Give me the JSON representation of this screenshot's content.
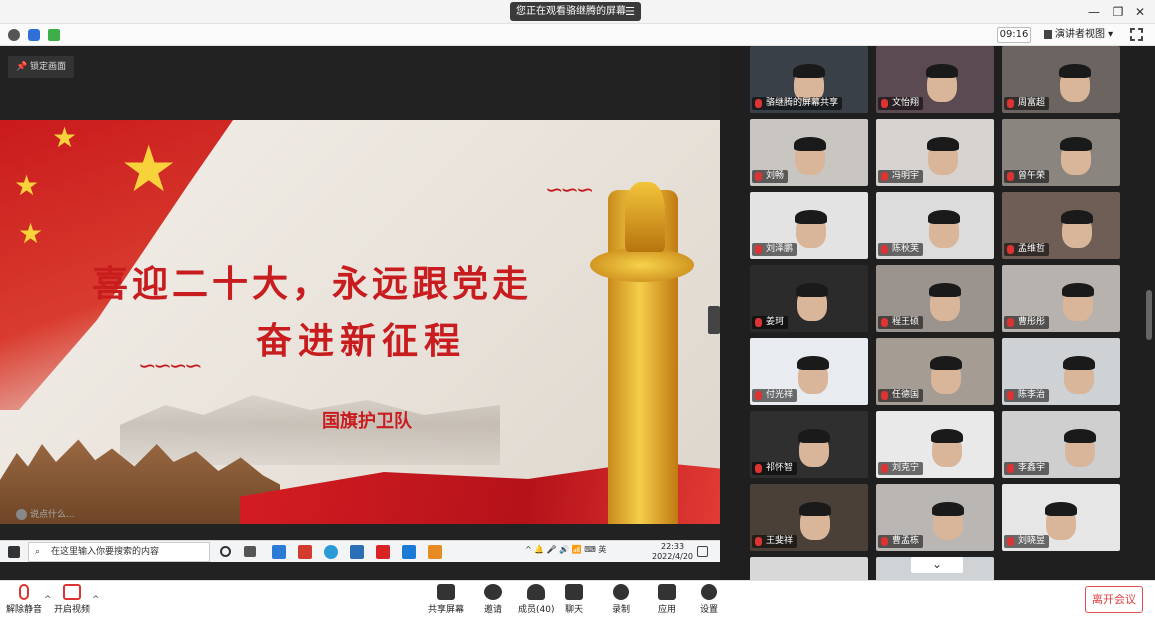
{
  "titlebar": {
    "sharing_notice": "您正在观看骆继腾的屏幕",
    "menu_glyph": "☰",
    "minimize": "—",
    "restore": "❐",
    "close": "✕"
  },
  "infobar": {
    "time": "09:16",
    "view_mode": "演讲者视图"
  },
  "share": {
    "lock_label": "锁定画面",
    "slide": {
      "headline_1": "喜迎二十大，永远跟党走",
      "headline_2": "奋进新征程",
      "subtitle": "国旗护卫队"
    },
    "chat_placeholder": "说点什么...",
    "taskbar": {
      "search_placeholder": "在这里输入你要搜索的内容",
      "tray_text": "^ 🔔 🎤 🔊 📶 ⌨ 英",
      "time": "22:33",
      "date": "2022/4/20"
    }
  },
  "gallery": {
    "participants": [
      {
        "name": "骆继腾的屏幕共享"
      },
      {
        "name": "文怡翔"
      },
      {
        "name": "周富超"
      },
      {
        "name": "刘畅"
      },
      {
        "name": "冯明宇"
      },
      {
        "name": "曾午荣"
      },
      {
        "name": "刘泽鹏"
      },
      {
        "name": "陈秋芙"
      },
      {
        "name": "孟维哲"
      },
      {
        "name": "姜珂"
      },
      {
        "name": "程王硕"
      },
      {
        "name": "曹彤彤"
      },
      {
        "name": "付光祥"
      },
      {
        "name": "任德国"
      },
      {
        "name": "陈李治"
      },
      {
        "name": "祁怀智"
      },
      {
        "name": "刘克宁"
      },
      {
        "name": "李鑫宇"
      },
      {
        "name": "王斐祥"
      },
      {
        "name": "曹孟栋"
      },
      {
        "name": "刘晓昱"
      }
    ],
    "more_glyph": "⌄"
  },
  "toolbar": {
    "unmute": "解除静音",
    "start_video": "开启视频",
    "share_screen": "共享屏幕",
    "invite": "邀请",
    "members": "成员(40)",
    "chat": "聊天",
    "record": "录制",
    "apps": "应用",
    "settings": "设置",
    "leave": "离开会议"
  }
}
